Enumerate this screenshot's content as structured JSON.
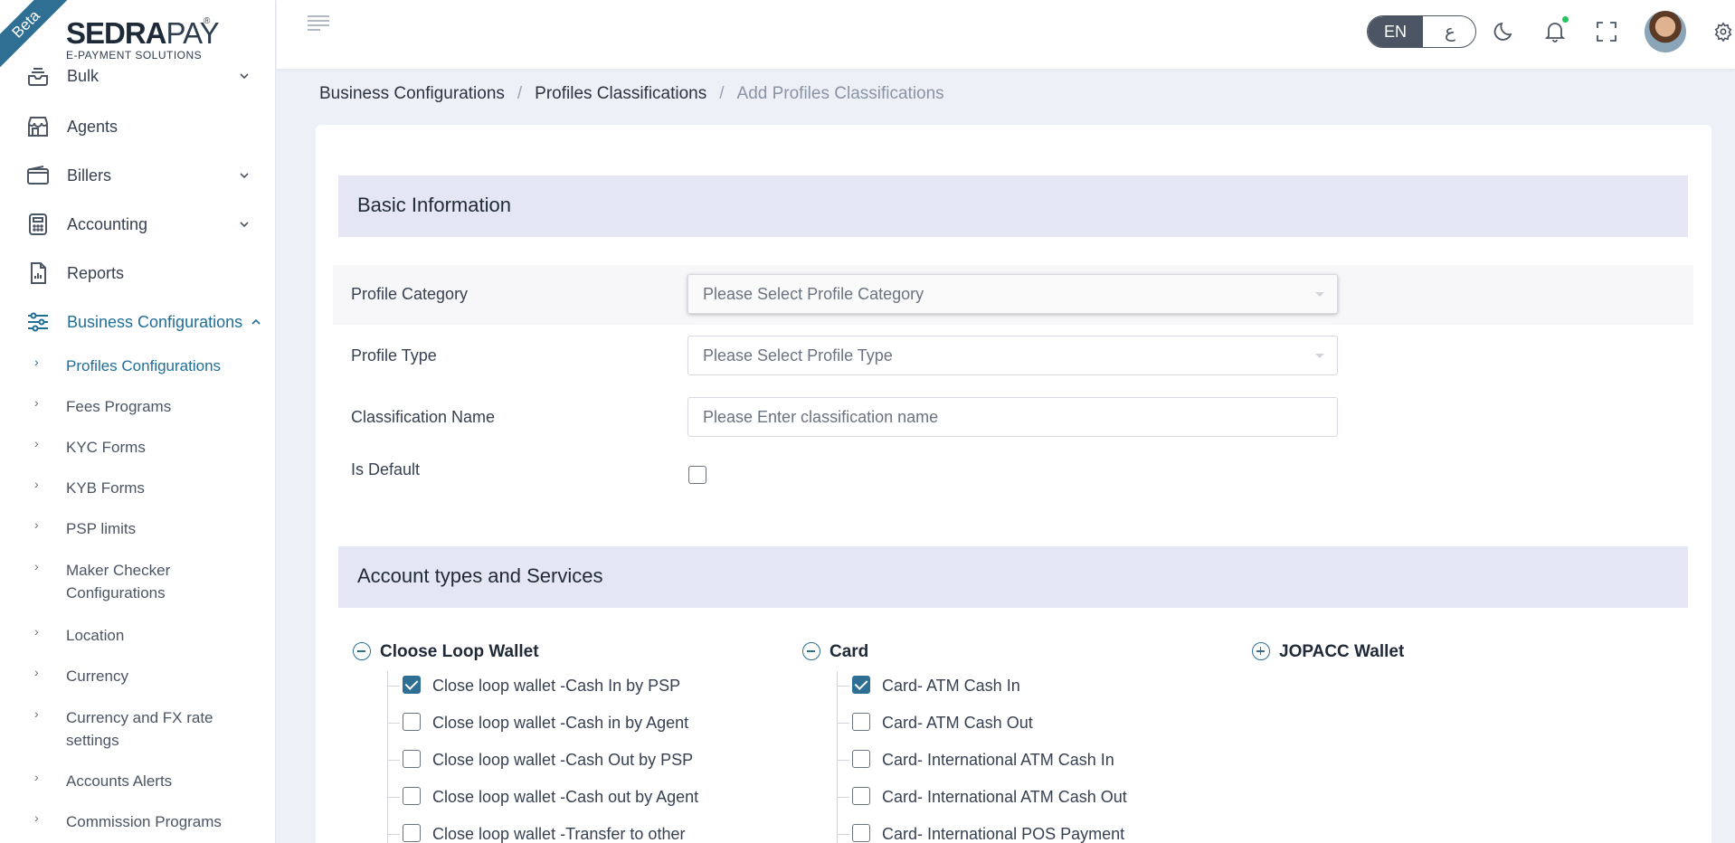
{
  "brand": {
    "badge": "Beta",
    "name_bold": "SEDRA",
    "name_light": "PAY",
    "registered": "®",
    "tagline": "E-PAYMENT SOLUTIONS"
  },
  "sidebar": {
    "items": [
      {
        "label": "Bulk",
        "icon": "tray-icon",
        "has_chevron": true
      },
      {
        "label": "Agents",
        "icon": "store-icon",
        "has_chevron": false
      },
      {
        "label": "Billers",
        "icon": "wallet-icon",
        "has_chevron": true
      },
      {
        "label": "Accounting",
        "icon": "calculator-icon",
        "has_chevron": true
      },
      {
        "label": "Reports",
        "icon": "report-icon",
        "has_chevron": false
      },
      {
        "label": "Business Configurations",
        "icon": "sliders-icon",
        "has_chevron": true,
        "expanded": true
      }
    ],
    "sub_items": [
      {
        "label": "Profiles Configurations",
        "active": true
      },
      {
        "label": "Fees Programs"
      },
      {
        "label": "KYC Forms"
      },
      {
        "label": "KYB Forms"
      },
      {
        "label": "PSP limits"
      },
      {
        "label": "Maker Checker Configurations"
      },
      {
        "label": "Location"
      },
      {
        "label": "Currency"
      },
      {
        "label": "Currency and FX rate settings"
      },
      {
        "label": "Accounts Alerts"
      },
      {
        "label": "Commission Programs"
      }
    ]
  },
  "topbar": {
    "lang_en": "EN",
    "lang_ar": "ع",
    "colors": {
      "accent": "#2e6f93",
      "notification_dot": "#22c55e"
    }
  },
  "breadcrumb": [
    "Business Configurations",
    "Profiles Classifications",
    "Add Profiles Classifications"
  ],
  "basic_info": {
    "title": "Basic Information",
    "profile_category": {
      "label": "Profile Category",
      "placeholder": "Please Select Profile Category"
    },
    "profile_type": {
      "label": "Profile Type",
      "placeholder": "Please Select Profile Type"
    },
    "classification_name": {
      "label": "Classification Name",
      "placeholder": "Please Enter classification name"
    },
    "is_default": {
      "label": "Is Default",
      "checked": false
    }
  },
  "services": {
    "title": "Account types and Services",
    "groups": [
      {
        "title": "Cloose Loop Wallet",
        "expanded": true,
        "options": [
          {
            "label": "Close loop wallet -Cash In by PSP",
            "checked": true
          },
          {
            "label": "Close loop wallet -Cash in by Agent",
            "checked": false
          },
          {
            "label": "Close loop wallet -Cash Out by PSP",
            "checked": false
          },
          {
            "label": "Close loop wallet -Cash out by Agent",
            "checked": false
          },
          {
            "label": "Close loop wallet -Transfer to other",
            "checked": false
          }
        ]
      },
      {
        "title": "Card",
        "expanded": true,
        "options": [
          {
            "label": "Card- ATM Cash In",
            "checked": true
          },
          {
            "label": "Card- ATM Cash Out",
            "checked": false
          },
          {
            "label": "Card- International ATM Cash In",
            "checked": false
          },
          {
            "label": "Card- International ATM Cash Out",
            "checked": false
          },
          {
            "label": "Card- International POS Payment",
            "checked": false
          }
        ]
      },
      {
        "title": "JOPACC Wallet",
        "expanded": false,
        "options": []
      }
    ]
  }
}
